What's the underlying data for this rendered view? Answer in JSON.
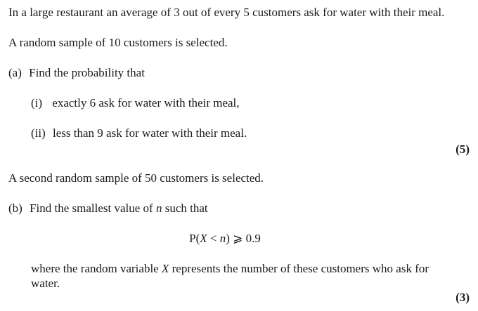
{
  "intro": "In a large restaurant an average of 3 out of every 5 customers ask for water with their meal.",
  "sample1": "A random sample of 10 customers is selected.",
  "part_a": {
    "label": "(a)",
    "text": "Find the probability that",
    "sub_i_label": "(i)",
    "sub_i_text": "exactly 6 ask for water with their meal,",
    "sub_ii_label": "(ii)",
    "sub_ii_text": "less than 9 ask for water with their meal.",
    "marks": "(5)"
  },
  "sample2": "A second random sample of 50 customers is selected.",
  "part_b": {
    "label": "(b)",
    "text_pre": "Find the smallest value of ",
    "var_n": "n",
    "text_post": " such that",
    "formula_p": "P(",
    "formula_x": "X",
    "formula_lt": " < ",
    "formula_n": "n",
    "formula_rest": ") ⩾ 0.9",
    "where_pre": "where the random variable ",
    "where_x": "X",
    "where_post": " represents the number of these customers who ask for",
    "where_line2": "water.",
    "marks": "(3)"
  }
}
